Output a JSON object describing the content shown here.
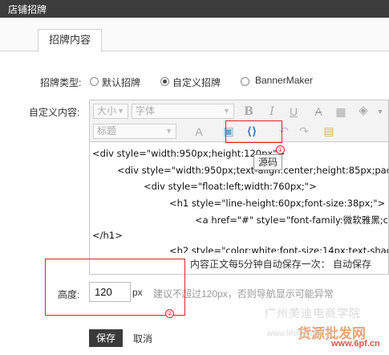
{
  "window": {
    "title": "店铺招牌"
  },
  "tabs": [
    {
      "label": "招牌内容"
    }
  ],
  "form": {
    "type_label": "招牌类型:",
    "type_options": [
      {
        "label": "默认招牌",
        "selected": false
      },
      {
        "label": "自定义招牌",
        "selected": true
      },
      {
        "label": "BannerMaker",
        "selected": false
      }
    ],
    "content_label": "自定义内容:",
    "height_label": "高度:",
    "height_value": "120",
    "height_unit": "px",
    "height_hint": "建议不超过120px，否则导航显示可能异常"
  },
  "editor": {
    "toolbar": {
      "size_select": "大小",
      "font_select": "字体",
      "heading_select": "标题",
      "source_tooltip": "源码"
    },
    "code_lines": [
      "<div style=\"width:950px;height:120px\">",
      "<div style=\"width:950px;text-align:center;height:85px;padd",
      "<div style=\"float:left;width:760px;\">",
      "<h1 style=\"line-height:60px;font-size:38px;\">",
      "<a href=\"#\" style=\"font-family:微软雅黑;c",
      "</h1>",
      "<h2 style=\"color:white;font-size:14px;text-shad"
    ],
    "status": "内容正文每5分钟自动保存一次：   自动保存"
  },
  "annotations": {
    "marker1": "①",
    "marker2": "②"
  },
  "actions": {
    "save": "保存",
    "cancel": "取消"
  },
  "watermarks": {
    "line1": "广州美迪电商学院",
    "line2": "货源批发网",
    "line3": "www.Meijie.com.cn",
    "line4": "www.6pf.cn"
  }
}
